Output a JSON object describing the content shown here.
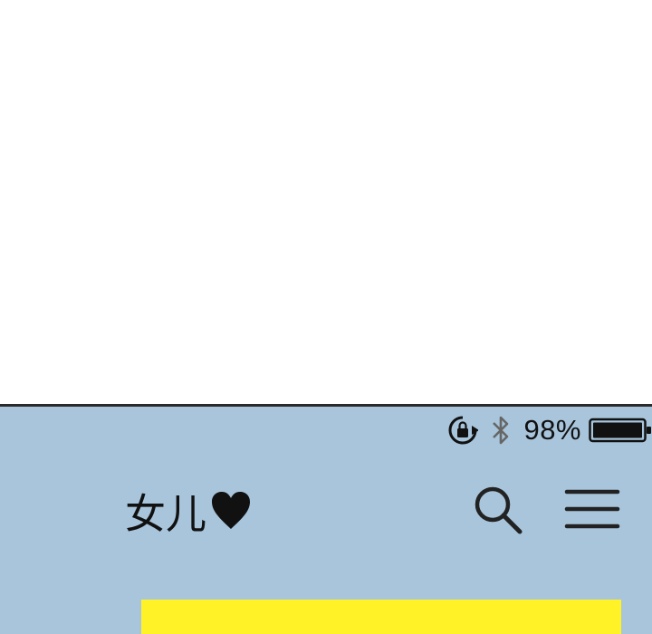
{
  "status_bar": {
    "battery_percent": "98%",
    "icons": [
      "lock-rotation-icon",
      "bluetooth-icon",
      "battery-icon"
    ]
  },
  "nav": {
    "title": "女儿",
    "title_icon": "heart-icon",
    "search_icon": "search-icon",
    "menu_icon": "hamburger-menu-icon"
  },
  "colors": {
    "screen_background": "#a8c5dc",
    "banner": "#fff227",
    "text": "#111111"
  }
}
